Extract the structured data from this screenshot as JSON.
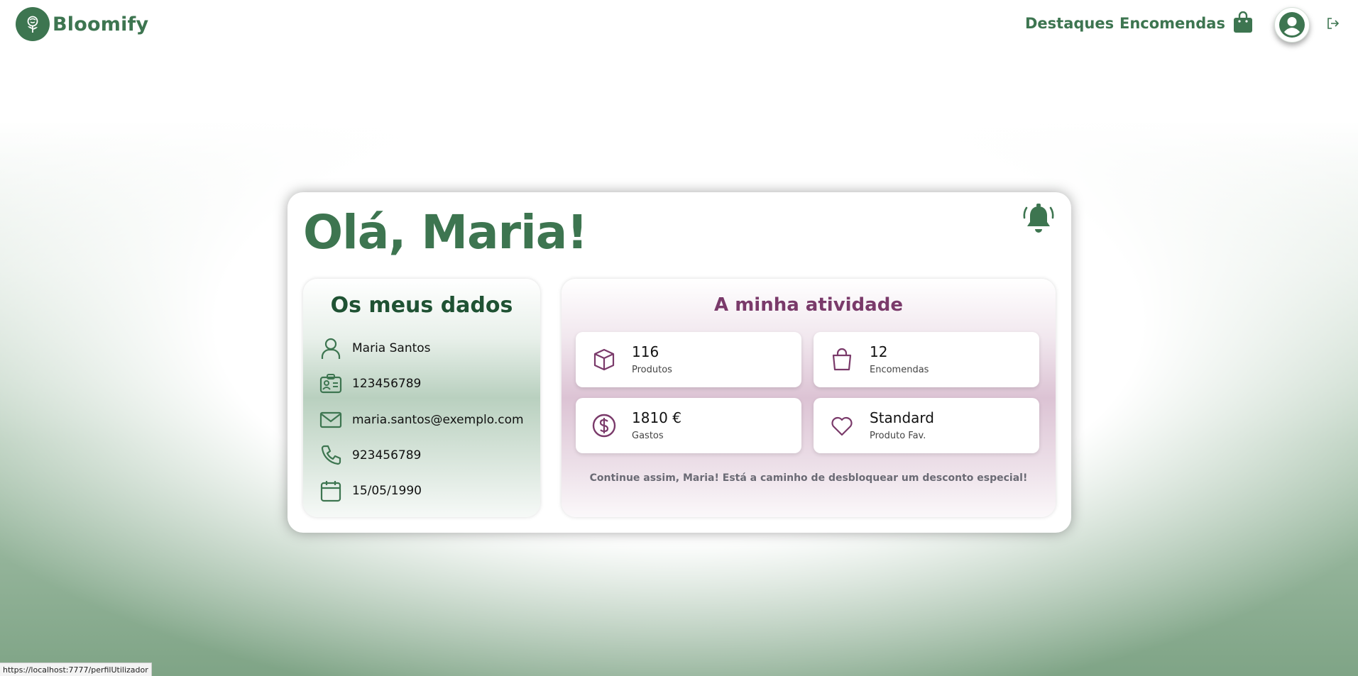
{
  "brand": {
    "name": "Bloomify",
    "logo_icon": "rose-icon"
  },
  "nav": {
    "destaques": "Destaques",
    "encomendas": "Encomendas",
    "bag_icon": "shopping-bag-icon",
    "profile_icon": "user-circle-icon",
    "logout_icon": "logout-icon"
  },
  "greeting": "Olá, Maria!",
  "notifications_icon": "bell-icon",
  "my_data": {
    "title": "Os meus dados",
    "rows": [
      {
        "icon": "user-icon",
        "value": "Maria Santos"
      },
      {
        "icon": "id-card-icon",
        "value": "123456789"
      },
      {
        "icon": "mail-icon",
        "value": "maria.santos@exemplo.com"
      },
      {
        "icon": "phone-icon",
        "value": "923456789"
      },
      {
        "icon": "calendar-icon",
        "value": "15/05/1990"
      }
    ]
  },
  "activity": {
    "title": "A minha atividade",
    "stats": [
      {
        "icon": "box-icon",
        "value": "116",
        "label": "Produtos"
      },
      {
        "icon": "bag-icon",
        "value": "12",
        "label": "Encomendas"
      },
      {
        "icon": "dollar-icon",
        "value": "1810 €",
        "label": "Gastos"
      },
      {
        "icon": "heart-icon",
        "value": "Standard",
        "label": "Produto Fav."
      }
    ],
    "message": "Continue assim, Maria! Está a caminho de desbloquear um desconto especial!"
  },
  "status_url": "https://localhost:7777/perfilUtilizador",
  "colors": {
    "primary_green": "#3d7550",
    "dark_green": "#1f5233",
    "purple": "#7a3a6a"
  }
}
